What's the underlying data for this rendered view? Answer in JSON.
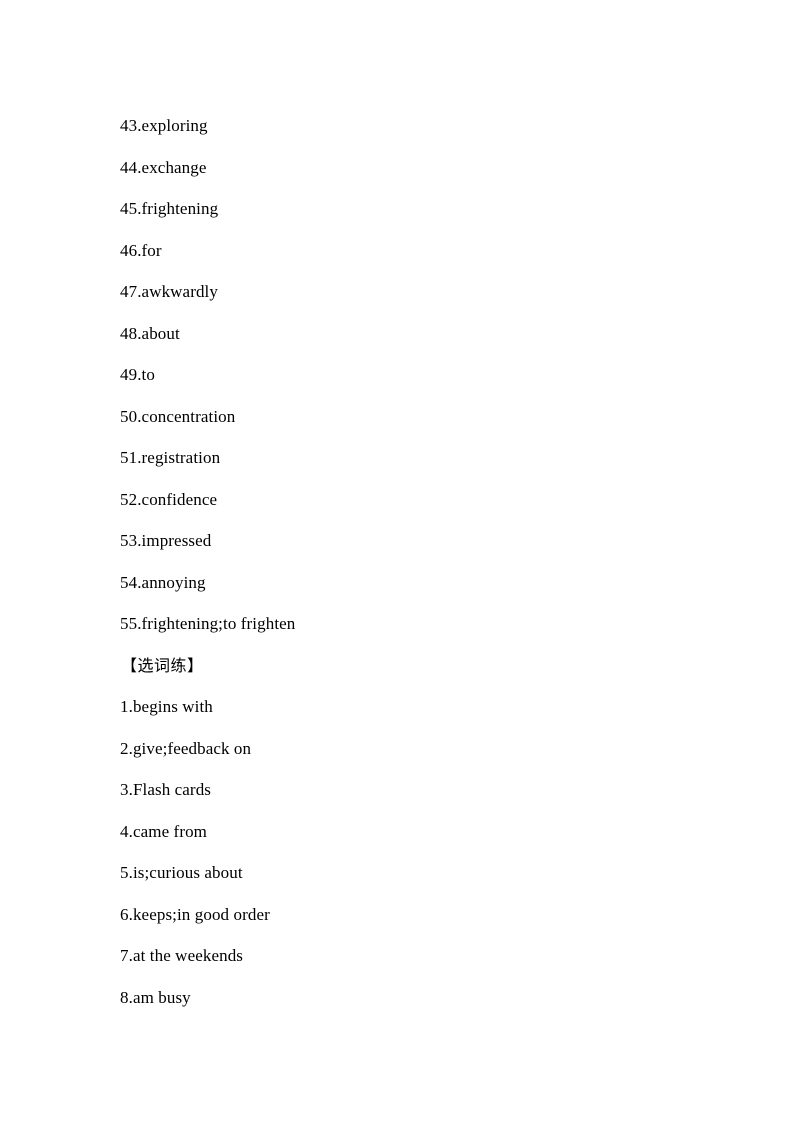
{
  "document": {
    "page_background": "#ffffff",
    "text_color": "#000000",
    "blocks": [
      {
        "kind": "answer",
        "text": "43.exploring"
      },
      {
        "kind": "answer",
        "text": "44.exchange"
      },
      {
        "kind": "answer",
        "text": "45.frightening"
      },
      {
        "kind": "answer",
        "text": "46.for"
      },
      {
        "kind": "answer",
        "text": "47.awkwardly"
      },
      {
        "kind": "answer",
        "text": "48.about"
      },
      {
        "kind": "answer",
        "text": "49.to"
      },
      {
        "kind": "answer",
        "text": "50.concentration"
      },
      {
        "kind": "answer",
        "text": "51.registration"
      },
      {
        "kind": "answer",
        "text": "52.confidence"
      },
      {
        "kind": "answer",
        "text": "53.impressed"
      },
      {
        "kind": "answer",
        "text": "54.annoying"
      },
      {
        "kind": "answer",
        "text": "55.frightening;to frighten"
      },
      {
        "kind": "heading",
        "text": "【选词练】"
      },
      {
        "kind": "answer",
        "text": "1.begins with"
      },
      {
        "kind": "answer",
        "text": "2.give;feedback on"
      },
      {
        "kind": "answer",
        "text": "3.Flash cards"
      },
      {
        "kind": "answer",
        "text": "4.came from"
      },
      {
        "kind": "answer",
        "text": "5.is;curious about"
      },
      {
        "kind": "answer",
        "text": "6.keeps;in good order"
      },
      {
        "kind": "answer",
        "text": "7.at the weekends"
      },
      {
        "kind": "answer",
        "text": "8.am busy"
      }
    ]
  }
}
